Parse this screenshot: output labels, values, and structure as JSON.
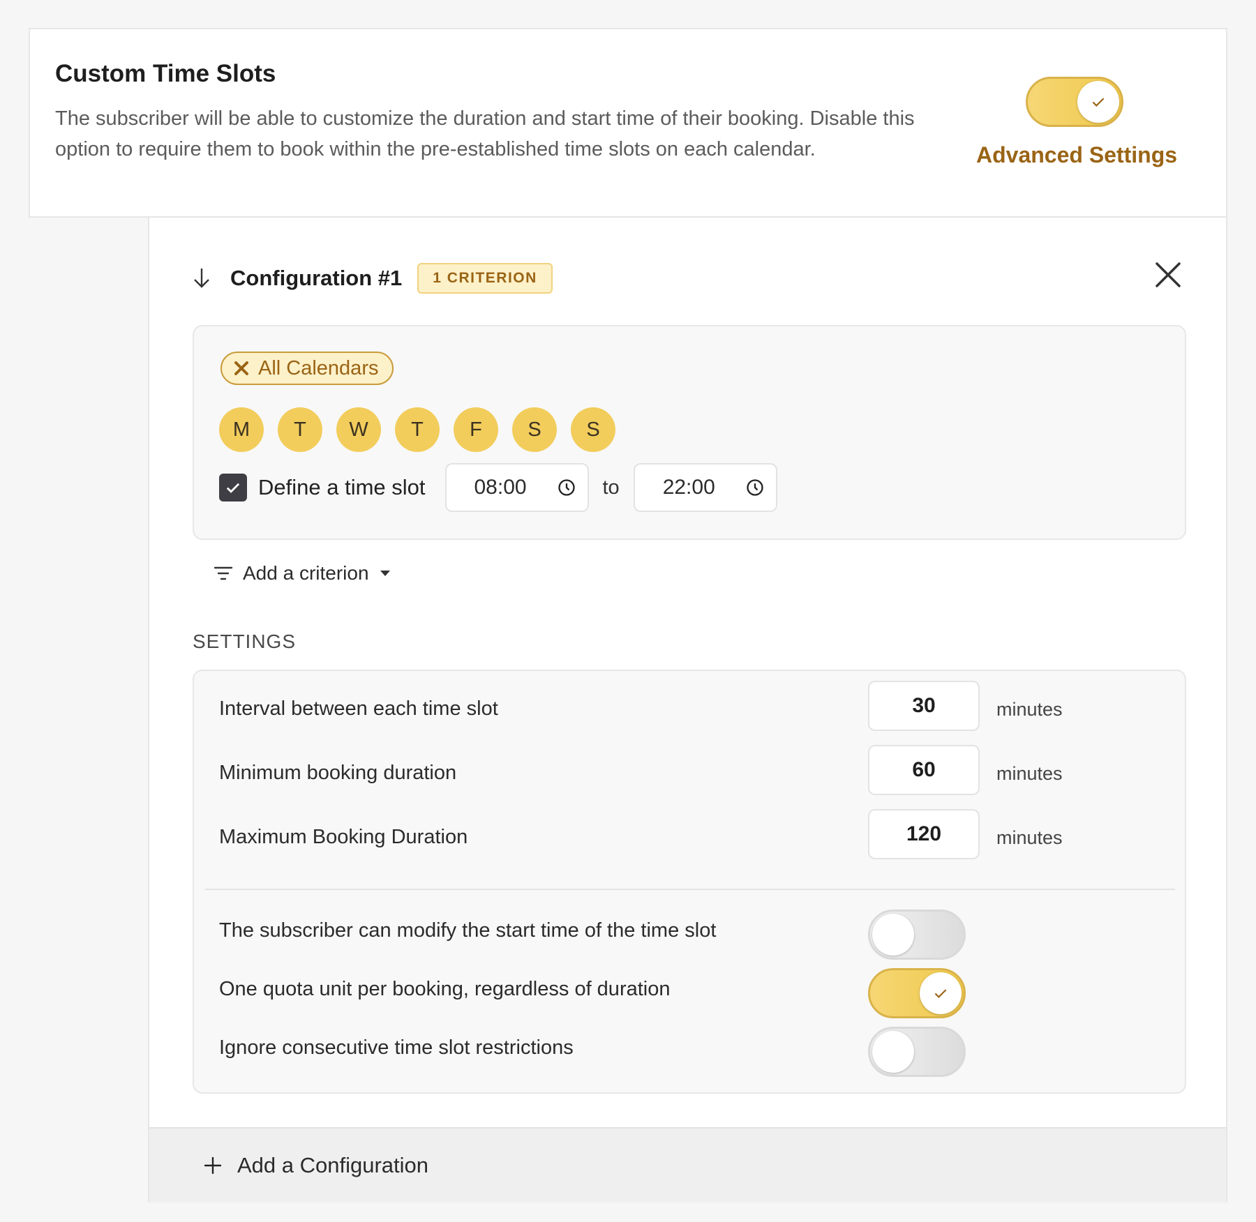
{
  "header": {
    "title": "Custom Time Slots",
    "description": "The subscriber will be able to customize the duration and start time of their booking. Disable this option to require them to book within the pre-established time slots on each calendar.",
    "enabled": true,
    "advanced_settings_label": "Advanced Settings"
  },
  "configuration": {
    "title": "Configuration #1",
    "criterion_badge": "1 CRITERION",
    "calendar_chip": "All Calendars",
    "days": [
      "M",
      "T",
      "W",
      "T",
      "F",
      "S",
      "S"
    ],
    "define_slot_label": "Define a time slot",
    "define_slot_checked": true,
    "start_time": "08:00",
    "to_label": "to",
    "end_time": "22:00",
    "add_criterion_label": "Add a criterion"
  },
  "settings": {
    "heading": "SETTINGS",
    "interval": {
      "label": "Interval between each time slot",
      "value": "30",
      "unit": "minutes"
    },
    "min_duration": {
      "label": "Minimum booking duration",
      "value": "60",
      "unit": "minutes"
    },
    "max_duration": {
      "label": "Maximum Booking Duration",
      "value": "120",
      "unit": "minutes"
    },
    "toggles": [
      {
        "label": "The subscriber can modify the start time of the time slot",
        "on": false
      },
      {
        "label": "One quota unit per booking, regardless of duration",
        "on": true
      },
      {
        "label": "Ignore consecutive time slot restrictions",
        "on": false
      }
    ]
  },
  "footer": {
    "add_configuration_label": "Add a Configuration"
  },
  "colors": {
    "accent": "#f2cd5c",
    "accent_text": "#9a6415"
  }
}
